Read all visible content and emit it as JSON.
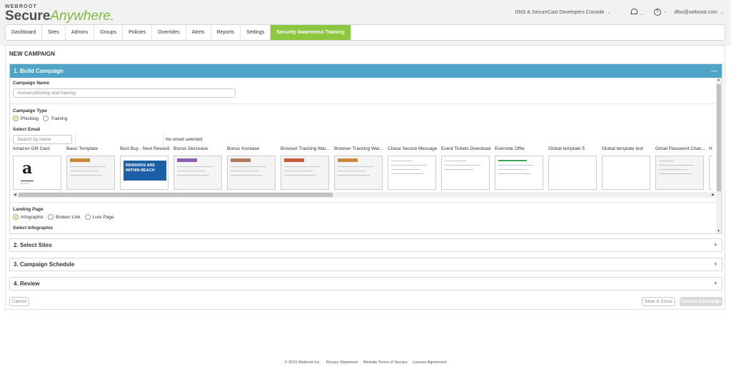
{
  "brand": {
    "small": "WEBROOT",
    "bold": "Secure",
    "italic": "Anywhere."
  },
  "header": {
    "console": "DNS & SecureCast Developers Console",
    "help": "?",
    "user": "dfox@webroot.com"
  },
  "nav": {
    "items": [
      {
        "label": "Dashboard"
      },
      {
        "label": "Sites"
      },
      {
        "label": "Admins"
      },
      {
        "label": "Groups"
      },
      {
        "label": "Policies"
      },
      {
        "label": "Overrides"
      },
      {
        "label": "Alerts"
      },
      {
        "label": "Reports"
      },
      {
        "label": "Settings"
      },
      {
        "label": "Security Awareness Training"
      }
    ],
    "active": "Security Awareness Training",
    "active_color": "#8dc63f"
  },
  "page": {
    "title": "NEW CAMPAIGN"
  },
  "build": {
    "title": "1. Build Campaign",
    "collapse": "—",
    "header_color": "#4fa3c7",
    "campaign_name_label": "Campaign Name",
    "campaign_name_placeholder": "Annual phishing and training",
    "campaign_type_label": "Campaign Type",
    "type_options": [
      {
        "label": "Phishing",
        "selected": true
      },
      {
        "label": "Training",
        "selected": false
      }
    ],
    "select_email_label": "Select Email",
    "search_placeholder": "Search by name",
    "no_email": "No email selected",
    "templates": [
      {
        "name": "Amazon Gift Card",
        "style": "amazon",
        "logo": "a"
      },
      {
        "name": "Basic Template",
        "style": "doc"
      },
      {
        "name": "Best Buy - Next Reward",
        "style": "blue",
        "banner": "REWARDS ARE WITHIN REACH"
      },
      {
        "name": "Bonus Decrease",
        "style": "doc"
      },
      {
        "name": "Bonus Increase",
        "style": "doc"
      },
      {
        "name": "Browser Tracking War...",
        "style": "doc"
      },
      {
        "name": "Browser Tracking War...",
        "style": "doc"
      },
      {
        "name": "Chase Secure Message",
        "style": "plain"
      },
      {
        "name": "Event Tickets Download",
        "style": "plain"
      },
      {
        "name": "Evernote Offer",
        "style": "green"
      },
      {
        "name": "Global template 5",
        "style": "blank"
      },
      {
        "name": "Global template test",
        "style": "blank"
      },
      {
        "name": "Gmail Password Chan...",
        "style": "plain"
      },
      {
        "name": "HR",
        "style": "blank"
      }
    ],
    "landing_page_label": "Landing Page",
    "landing_options": [
      {
        "label": "Infographic",
        "selected": true
      },
      {
        "label": "Broken Link",
        "selected": false
      },
      {
        "label": "Lure Page",
        "selected": false
      }
    ],
    "select_infographic_label": "Select Infographic"
  },
  "sections": [
    {
      "title": "2. Select Sites",
      "icon": "+"
    },
    {
      "title": "3. Campaign Schedule",
      "icon": "+"
    },
    {
      "title": "4. Review",
      "icon": "+"
    }
  ],
  "actions": {
    "cancel": "Cancel",
    "save_close": "Save & Close",
    "launch": "Launch Campaign"
  },
  "footer": {
    "copyright": "© 2019 Webroot Inc.",
    "privacy": "Privacy Statement",
    "terms": "Website Terms of Service",
    "license": "License Agreement"
  }
}
